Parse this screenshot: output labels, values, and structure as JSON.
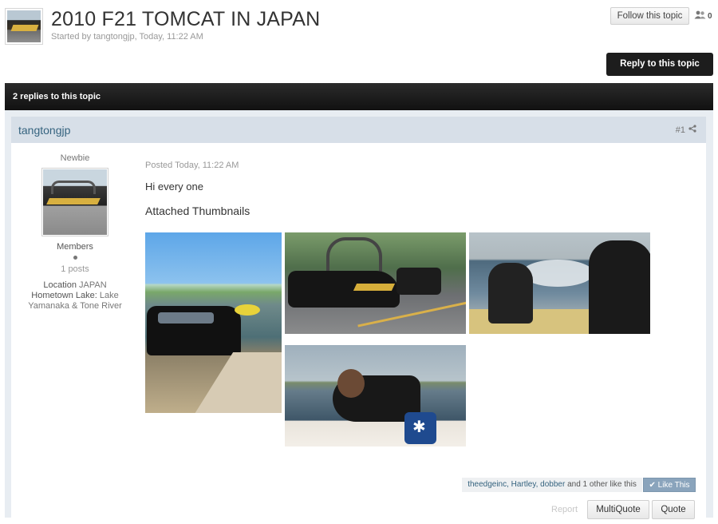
{
  "topic": {
    "title": "2010 F21 TOMCAT IN JAPAN",
    "started_by": "Started by tangtongjp, Today, 11:22 AM",
    "follow_label": "Follow this topic",
    "follower_count": "0",
    "reply_label": "Reply to this topic",
    "replies_count_label": "2 replies to this topic"
  },
  "post": {
    "author": "tangtongjp",
    "post_number": "#1",
    "rank": "Newbie",
    "group": "Members",
    "posts": "1 posts",
    "location_label": "Location",
    "location_value": "JAPAN",
    "hometown_label": "Hometown Lake:",
    "hometown_value": "Lake Yamanaka & Tone River",
    "posted": "Posted Today, 11:22 AM",
    "body": "Hi every one",
    "attached_title": "Attached Thumbnails",
    "thumbnails": [
      "thumbnail-1",
      "thumbnail-2",
      "thumbnail-3",
      "thumbnail-4"
    ],
    "likes_names": "theedgeinc, Hartley, dobber",
    "likes_suffix": "and 1 other like this",
    "like_label": "Like This",
    "report_label": "Report",
    "multiquote_label": "MultiQuote",
    "quote_label": "Quote"
  },
  "icons": {
    "followers": "people-icon",
    "share": "share-icon",
    "like": "check-icon",
    "status": "offline-dot-icon"
  },
  "colors": {
    "author_link": "#35637f",
    "post_header": "#d7dfe8",
    "dark_bar": "#1d1d1d",
    "like_button": "#8aa4bc"
  }
}
